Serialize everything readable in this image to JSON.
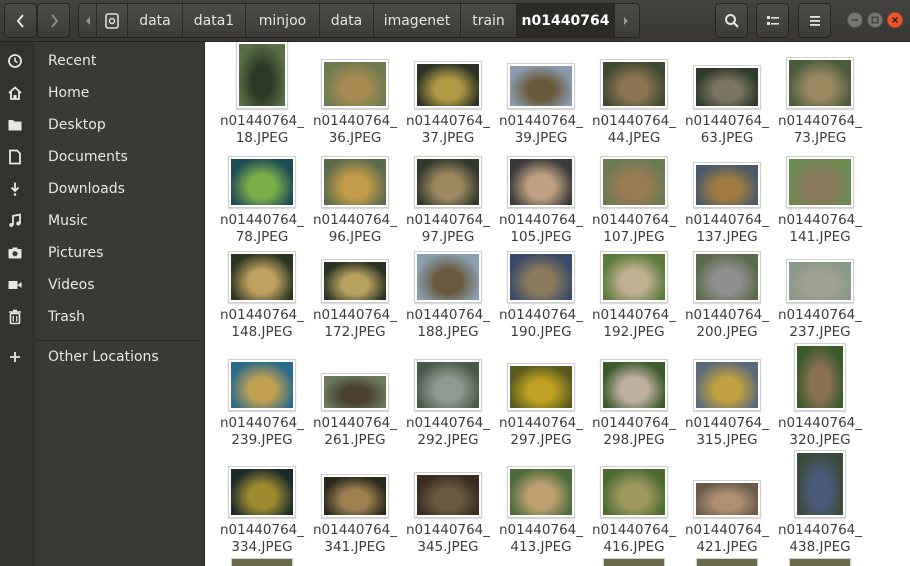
{
  "toolbar": {
    "breadcrumbs": [
      "data",
      "data1",
      "minjoo",
      "data",
      "imagenet",
      "train",
      "n01440764"
    ],
    "active_breadcrumb": "n01440764"
  },
  "sidebar": {
    "items": [
      {
        "label": "Recent",
        "icon": "clock-icon"
      },
      {
        "label": "Home",
        "icon": "home-icon"
      },
      {
        "label": "Desktop",
        "icon": "folder-icon"
      },
      {
        "label": "Documents",
        "icon": "document-icon"
      },
      {
        "label": "Downloads",
        "icon": "download-icon"
      },
      {
        "label": "Music",
        "icon": "music-icon"
      },
      {
        "label": "Pictures",
        "icon": "camera-icon"
      },
      {
        "label": "Videos",
        "icon": "video-icon"
      },
      {
        "label": "Trash",
        "icon": "trash-icon"
      }
    ],
    "other": {
      "label": "Other Locations",
      "icon": "plus-icon"
    }
  },
  "files": [
    {
      "prefix": "n01440764_",
      "suffix": "18.JPEG",
      "colors": [
        "#5a6f45",
        "#2b3a25"
      ]
    },
    {
      "prefix": "n01440764_",
      "suffix": "36.JPEG",
      "colors": [
        "#6d7a4e",
        "#a88a52"
      ]
    },
    {
      "prefix": "n01440764_",
      "suffix": "37.JPEG",
      "colors": [
        "#2c3324",
        "#b39945"
      ]
    },
    {
      "prefix": "n01440764_",
      "suffix": "39.JPEG",
      "colors": [
        "#8a9bb0",
        "#6b5a3a"
      ]
    },
    {
      "prefix": "n01440764_",
      "suffix": "44.JPEG",
      "colors": [
        "#3e4a30",
        "#8b7350"
      ]
    },
    {
      "prefix": "n01440764_",
      "suffix": "63.JPEG",
      "colors": [
        "#2f3a2a",
        "#7a7560"
      ]
    },
    {
      "prefix": "n01440764_",
      "suffix": "73.JPEG",
      "colors": [
        "#4a5a3a",
        "#9a8860"
      ]
    },
    {
      "prefix": "n01440764_",
      "suffix": "78.JPEG",
      "colors": [
        "#1c4a55",
        "#7ab04a"
      ]
    },
    {
      "prefix": "n01440764_",
      "suffix": "96.JPEG",
      "colors": [
        "#5b6a4a",
        "#c39a4a"
      ]
    },
    {
      "prefix": "n01440764_",
      "suffix": "97.JPEG",
      "colors": [
        "#30382a",
        "#a08860"
      ]
    },
    {
      "prefix": "n01440764_",
      "suffix": "105.JPEG",
      "colors": [
        "#3a3a3a",
        "#c0a080"
      ]
    },
    {
      "prefix": "n01440764_",
      "suffix": "107.JPEG",
      "colors": [
        "#6a7a50",
        "#9a7a55"
      ]
    },
    {
      "prefix": "n01440764_",
      "suffix": "137.JPEG",
      "colors": [
        "#4a5a6a",
        "#a07a40"
      ]
    },
    {
      "prefix": "n01440764_",
      "suffix": "141.JPEG",
      "colors": [
        "#6a8a50",
        "#8a7a5a"
      ]
    },
    {
      "prefix": "n01440764_",
      "suffix": "148.JPEG",
      "colors": [
        "#2a3520",
        "#c0a060"
      ]
    },
    {
      "prefix": "n01440764_",
      "suffix": "172.JPEG",
      "colors": [
        "#2a3322",
        "#b8a060"
      ]
    },
    {
      "prefix": "n01440764_",
      "suffix": "188.JPEG",
      "colors": [
        "#8aa0b0",
        "#6a5a40"
      ]
    },
    {
      "prefix": "n01440764_",
      "suffix": "190.JPEG",
      "colors": [
        "#3a4a6a",
        "#8a7a5a"
      ]
    },
    {
      "prefix": "n01440764_",
      "suffix": "192.JPEG",
      "colors": [
        "#5a7a3a",
        "#c0b090"
      ]
    },
    {
      "prefix": "n01440764_",
      "suffix": "200.JPEG",
      "colors": [
        "#5a6a4a",
        "#909090"
      ]
    },
    {
      "prefix": "n01440764_",
      "suffix": "237.JPEG",
      "colors": [
        "#8a9a8a",
        "#a0a090"
      ]
    },
    {
      "prefix": "n01440764_",
      "suffix": "239.JPEG",
      "colors": [
        "#2a6a8a",
        "#c0a050"
      ]
    },
    {
      "prefix": "n01440764_",
      "suffix": "261.JPEG",
      "colors": [
        "#6a7a5a",
        "#4a4030"
      ]
    },
    {
      "prefix": "n01440764_",
      "suffix": "292.JPEG",
      "colors": [
        "#4a5a4a",
        "#909a90"
      ]
    },
    {
      "prefix": "n01440764_",
      "suffix": "297.JPEG",
      "colors": [
        "#5a5a20",
        "#c0a020"
      ]
    },
    {
      "prefix": "n01440764_",
      "suffix": "298.JPEG",
      "colors": [
        "#3a5a2a",
        "#c0b0a0"
      ]
    },
    {
      "prefix": "n01440764_",
      "suffix": "315.JPEG",
      "colors": [
        "#5a6a7a",
        "#c0a040"
      ]
    },
    {
      "prefix": "n01440764_",
      "suffix": "320.JPEG",
      "colors": [
        "#3a5a2a",
        "#8a7050"
      ]
    },
    {
      "prefix": "n01440764_",
      "suffix": "334.JPEG",
      "colors": [
        "#1a2a2a",
        "#a08a30"
      ]
    },
    {
      "prefix": "n01440764_",
      "suffix": "341.JPEG",
      "colors": [
        "#2a2a1a",
        "#a08050"
      ]
    },
    {
      "prefix": "n01440764_",
      "suffix": "345.JPEG",
      "colors": [
        "#3a2a20",
        "#6a5a40"
      ]
    },
    {
      "prefix": "n01440764_",
      "suffix": "413.JPEG",
      "colors": [
        "#4a6a3a",
        "#c0a070"
      ]
    },
    {
      "prefix": "n01440764_",
      "suffix": "416.JPEG",
      "colors": [
        "#4a6a30",
        "#a09a60"
      ]
    },
    {
      "prefix": "n01440764_",
      "suffix": "421.JPEG",
      "colors": [
        "#6a5a4a",
        "#b09070"
      ]
    },
    {
      "prefix": "n01440764_",
      "suffix": "438.JPEG",
      "colors": [
        "#3a4a3a",
        "#4a5a7a"
      ]
    }
  ]
}
